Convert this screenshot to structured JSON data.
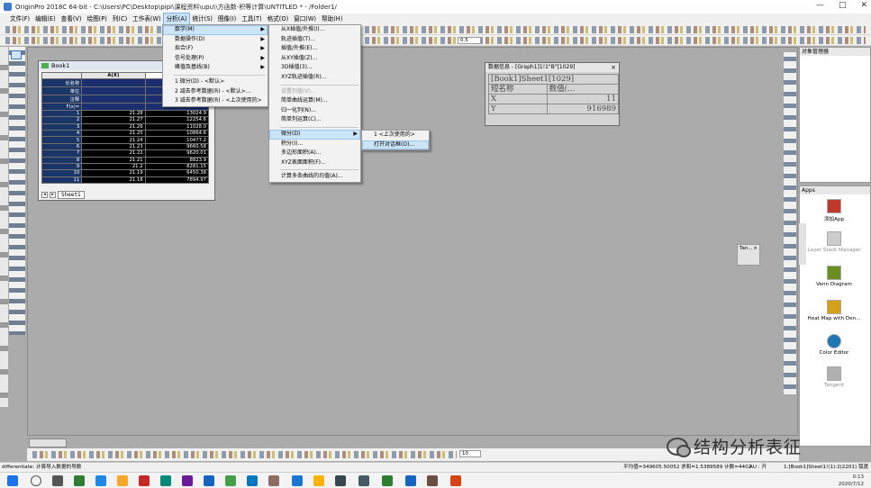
{
  "window": {
    "title": "OriginPro 2018C 64-bit - C:\\Users\\PC\\Desktop\\pipi\\课程资料\\upu\\\\方函数-积等计算\\UNTITLED * - /Folder1/",
    "controls": [
      "—",
      "□",
      "✕"
    ]
  },
  "menubar": [
    "文件(F)",
    "编辑(E)",
    "查看(V)",
    "绘图(P)",
    "列(C)",
    "工作表(W)",
    "分析(A)",
    "统计(S)",
    "图像(I)",
    "工具(T)",
    "格式(O)",
    "窗口(W)",
    "帮助(H)"
  ],
  "menubar_active": "分析(A)",
  "toolbar": {
    "font_size": "0.5",
    "zoom": "10"
  },
  "workbook": {
    "title": "Book1",
    "col_headers": [
      "A(X)",
      "B(Y)"
    ],
    "meta_rows": [
      "长名称",
      "单位",
      "注释",
      "F(x)="
    ],
    "rows": [
      {
        "n": "1",
        "a": "21.28",
        "b": "13024.9"
      },
      {
        "n": "2",
        "a": "21.27",
        "b": "12254.6"
      },
      {
        "n": "3",
        "a": "21.26",
        "b": "11028.0"
      },
      {
        "n": "4",
        "a": "21.25",
        "b": "10864.6"
      },
      {
        "n": "5",
        "a": "21.24",
        "b": "10477.2"
      },
      {
        "n": "6",
        "a": "21.23",
        "b": "9660.58"
      },
      {
        "n": "7",
        "a": "21.22",
        "b": "9620.01"
      },
      {
        "n": "8",
        "a": "21.21",
        "b": "8823.9"
      },
      {
        "n": "9",
        "a": "21.2",
        "b": "8281.15"
      },
      {
        "n": "10",
        "a": "21.19",
        "b": "6450.38"
      },
      {
        "n": "11",
        "a": "21.18",
        "b": "7894.97"
      }
    ],
    "sheet_tab": "Sheet1"
  },
  "data_info": {
    "title": "数据信息 - [Graph1]1!1\"B\"[1029]",
    "header": "[Book1]Sheet1[1029]",
    "col1": "短名称",
    "col2": "数值(...",
    "rows": [
      {
        "label": "X",
        "value": "11"
      },
      {
        "label": "Y",
        "value": "916989"
      }
    ]
  },
  "analysis_menu": [
    {
      "label": "数学(M)",
      "arrow": true,
      "highlight": true
    },
    {
      "label": "数据操作(D)",
      "arrow": true
    },
    {
      "label": "拟合(F)",
      "arrow": true
    },
    {
      "label": "信号处理(P)",
      "arrow": true
    },
    {
      "label": "峰值及基线(B)",
      "arrow": true
    },
    {
      "sep": true
    },
    {
      "label": "1 微分(D) - <默认>"
    },
    {
      "label": "2 减去参考数据(R) - <默认>..."
    },
    {
      "label": "3 减去参考数据(R) - <上次使用的>"
    }
  ],
  "math_menu": [
    {
      "label": "从X插值/外推(I)..."
    },
    {
      "label": "轨迹插值(T)..."
    },
    {
      "label": "插值/外推(E)..."
    },
    {
      "label": "从XY插值(Z)..."
    },
    {
      "label": "3D插值(3)..."
    },
    {
      "label": "XYZ轨迹插值(R)..."
    },
    {
      "sep": true
    },
    {
      "label": "设置列值(V)...",
      "disabled": true
    },
    {
      "label": "简单曲线运算(M)..."
    },
    {
      "label": "归一化列(N)..."
    },
    {
      "label": "简单列运算(C)..."
    },
    {
      "sep": true
    },
    {
      "label": "微分(D)",
      "arrow": true,
      "highlight": true
    },
    {
      "label": "积分(I)..."
    },
    {
      "label": "多边形面积(A)..."
    },
    {
      "label": "XYZ表面面积(F)..."
    },
    {
      "sep": true
    },
    {
      "label": "计算多条曲线的均值(A)..."
    }
  ],
  "diff_menu": [
    {
      "label": "1 <上次使用的>"
    },
    {
      "label": "打开对话框(O)...",
      "highlight": true
    }
  ],
  "tan_window": {
    "title": "Tan..."
  },
  "object_manager": {
    "title": "对象管理器"
  },
  "apps_panel": {
    "title": "Apps",
    "items": [
      {
        "label": "添加App",
        "color": "#c0392b"
      },
      {
        "label": "Layer Stack Manager",
        "color": "#bbbbbb",
        "dim": true
      },
      {
        "label": "Venn Diagram",
        "color": "#6b8e23"
      },
      {
        "label": "Heat Map with Den...",
        "color": "#d4a017"
      },
      {
        "label": "Color Editor",
        "color": "#1f77b4"
      },
      {
        "label": "Tangent",
        "color": "#999999",
        "dim": true
      }
    ]
  },
  "status": {
    "left": "differentiate: 计算导入数据的导数",
    "mid": "平均值=349605.50052 求和=1.5389589 计数=4402",
    "au": "AU : 开",
    "right": "1:[Book1]Sheet1!(1):2(2201)  弧度"
  },
  "clock": {
    "time": "0:13",
    "date": "2020/7/12"
  },
  "watermark": "结构分析表征"
}
